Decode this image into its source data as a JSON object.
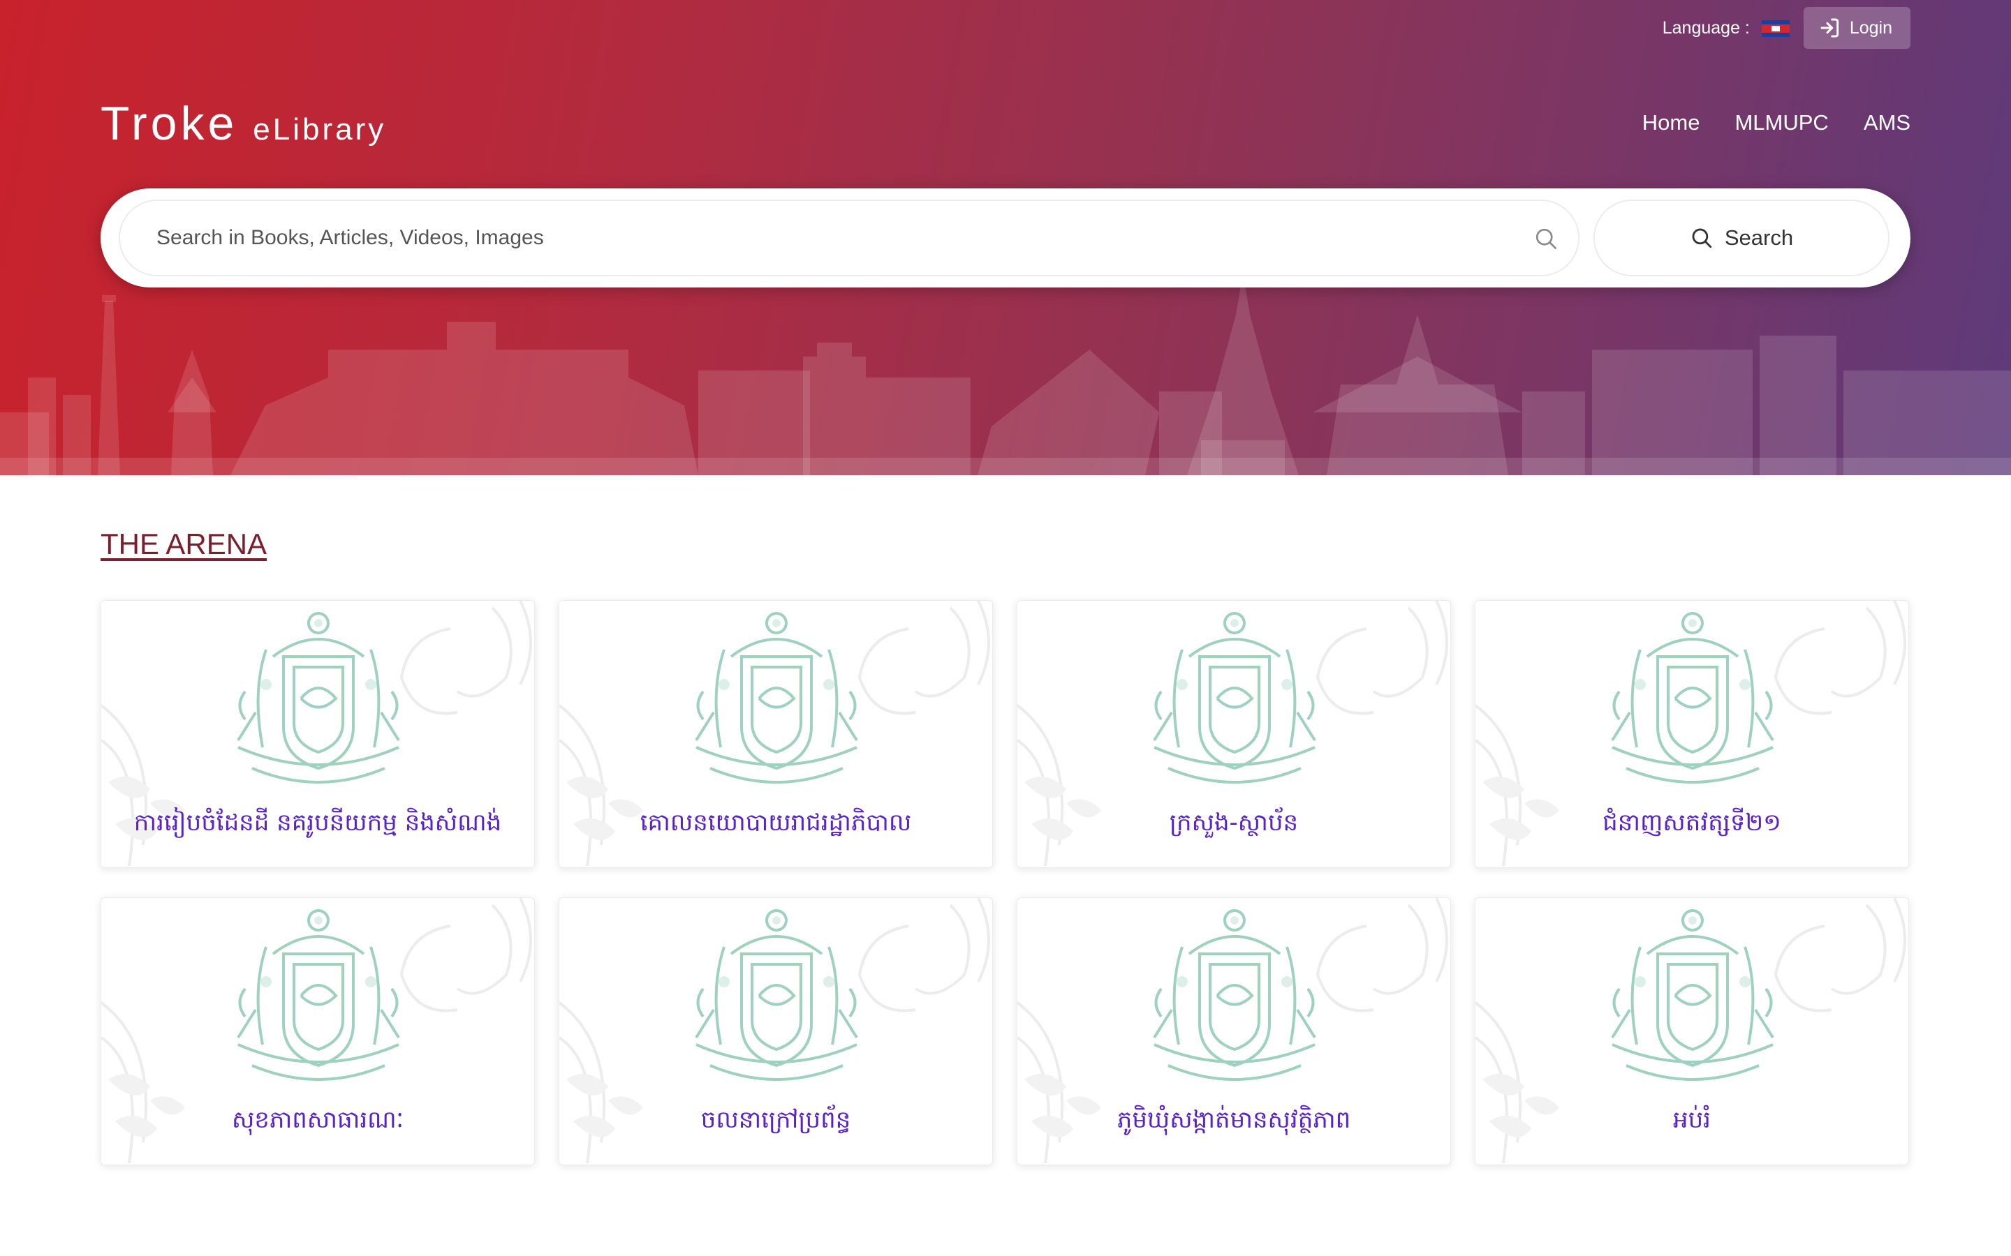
{
  "header": {
    "language_label": "Language :",
    "flag_icon": "cambodia-flag-icon",
    "login_label": "Login",
    "logo_main": "Troke",
    "logo_sub": "eLibrary",
    "nav": [
      {
        "label": "Home"
      },
      {
        "label": "MLMUPC"
      },
      {
        "label": "AMS"
      }
    ]
  },
  "search": {
    "placeholder": "Search in Books, Articles, Videos, Images",
    "button_label": "Search"
  },
  "section": {
    "title": "THE ARENA",
    "cards": [
      {
        "title": "ការរៀបចំដែនដី នគរូបនីយកម្ម និងសំណង់"
      },
      {
        "title": "គោលនយោបាយរាជរដ្ឋាភិបាល"
      },
      {
        "title": "ក្រសួង-ស្ថាប័ន"
      },
      {
        "title": "ជំនាញសតវត្សទី២១"
      },
      {
        "title": "សុខភាពសាធារណៈ"
      },
      {
        "title": "ចលនាក្រៅប្រព័ន្ធ"
      },
      {
        "title": "ភូមិឃុំសង្កាត់មានសុវត្ថិភាព"
      },
      {
        "title": "អប់រំ"
      }
    ]
  },
  "colors": {
    "gradient_start": "#c8222c",
    "gradient_end": "#5e3a7a",
    "card_title": "#5a22c9",
    "section_title": "#7b1f2e",
    "emblem": "#9fd1bf"
  }
}
